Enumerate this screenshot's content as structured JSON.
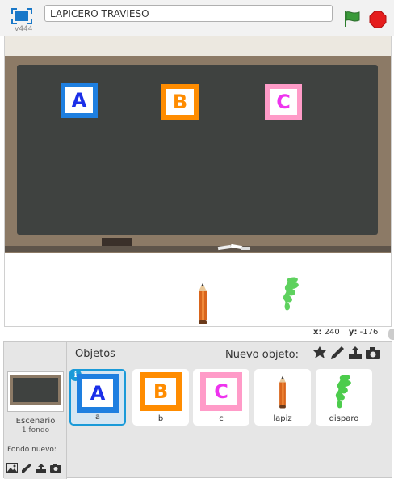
{
  "app": {
    "version": "v444",
    "project_title": "LAPICERO TRAVIESO"
  },
  "stage": {
    "tiles": [
      {
        "letter": "A",
        "color": "#1e7fe0",
        "letter_color": "#1b2fe8"
      },
      {
        "letter": "B",
        "color": "#ff8c00",
        "letter_color": "#ff8c00"
      },
      {
        "letter": "C",
        "color": "#ff9bc8",
        "letter_color": "#ee33ee"
      }
    ],
    "board_color": "#3f4240",
    "frame_color": "#8c7a66"
  },
  "coords": {
    "x_label": "x:",
    "x_value": "240",
    "y_label": "y:",
    "y_value": "-176"
  },
  "panel": {
    "objects_label": "Objetos",
    "new_object_label": "Nuevo objeto:",
    "stage_name": "Escenario",
    "stage_backdrop_count": "1 fondo",
    "new_backdrop_label": "Fondo nuevo:",
    "new_object_icons": [
      "sprite-library-icon",
      "paint-icon",
      "upload-icon",
      "camera-icon"
    ],
    "new_backdrop_icons": [
      "backdrop-library-icon",
      "paint-icon",
      "upload-icon",
      "camera-icon"
    ],
    "sprites": [
      {
        "name": "a",
        "selected": true
      },
      {
        "name": "b",
        "selected": false
      },
      {
        "name": "c",
        "selected": false
      },
      {
        "name": "lapiz",
        "selected": false
      },
      {
        "name": "disparo",
        "selected": false
      }
    ],
    "info_badge": "i"
  }
}
